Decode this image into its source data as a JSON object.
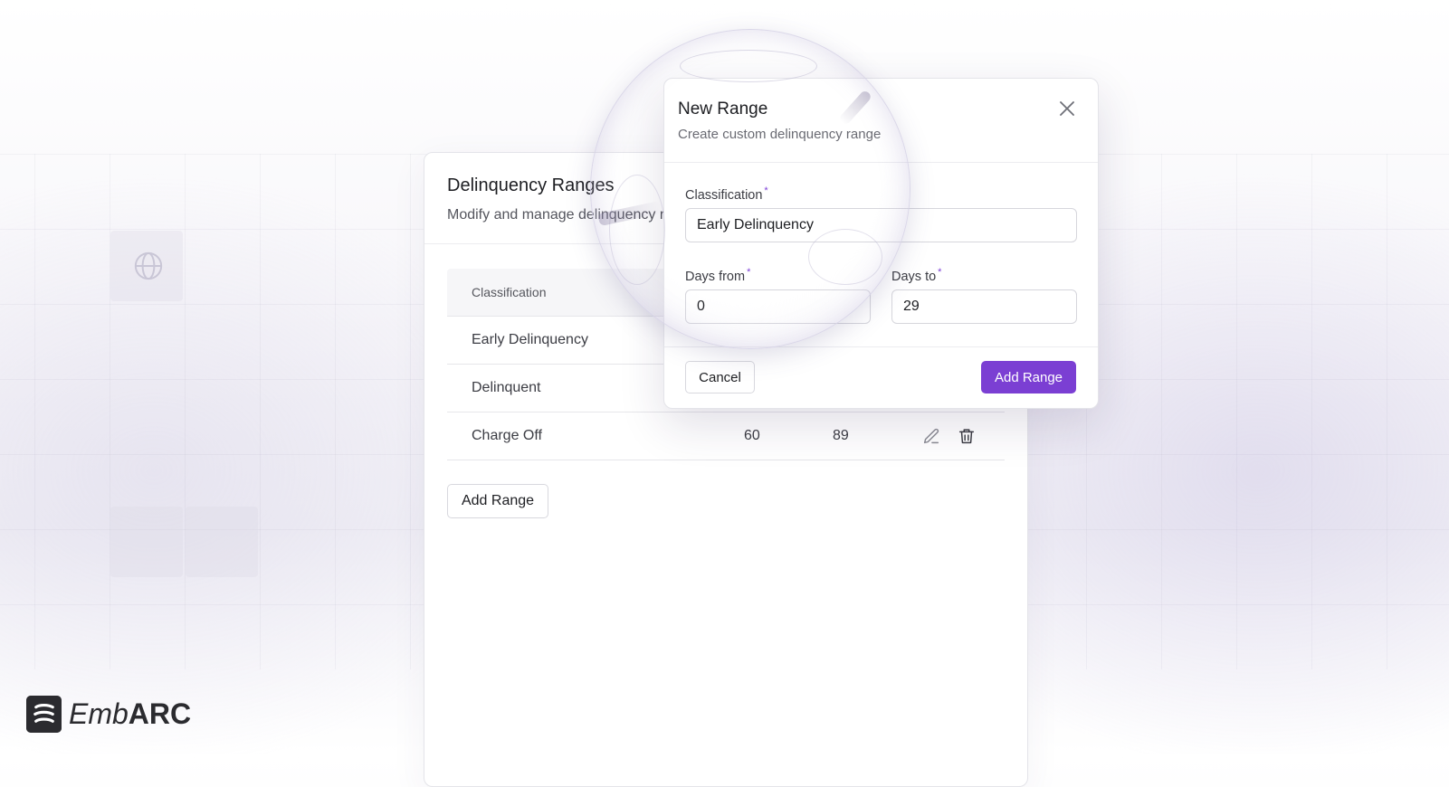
{
  "brand": {
    "name_light": "Emb",
    "name_bold": "ARC"
  },
  "card": {
    "title": "Delinquency Ranges",
    "subtitle": "Modify and manage delinquency ranges",
    "table": {
      "columns": [
        "Classification"
      ],
      "rows": [
        {
          "name": "Early Delinquency",
          "from": "",
          "to": ""
        },
        {
          "name": "Delinquent",
          "from": "",
          "to": ""
        },
        {
          "name": "Charge Off",
          "from": "60",
          "to": "89"
        }
      ]
    },
    "add_button": "Add Range"
  },
  "modal": {
    "title": "New Range",
    "subtitle": "Create custom delinquency range",
    "classification_label": "Classification",
    "classification_value": "Early Delinquency",
    "days_from_label": "Days from",
    "days_from_value": "0",
    "days_to_label": "Days to",
    "days_to_value": "29",
    "required_mark": "*",
    "cancel_label": "Cancel",
    "submit_label": "Add Range"
  },
  "colors": {
    "accent": "#7b3fd3",
    "text": "#1d1e22",
    "muted": "#54555d",
    "border": "#e4e4e9"
  },
  "icons": [
    "globe-icon",
    "edit-icon",
    "trash-icon",
    "close-icon",
    "logo-icon"
  ]
}
